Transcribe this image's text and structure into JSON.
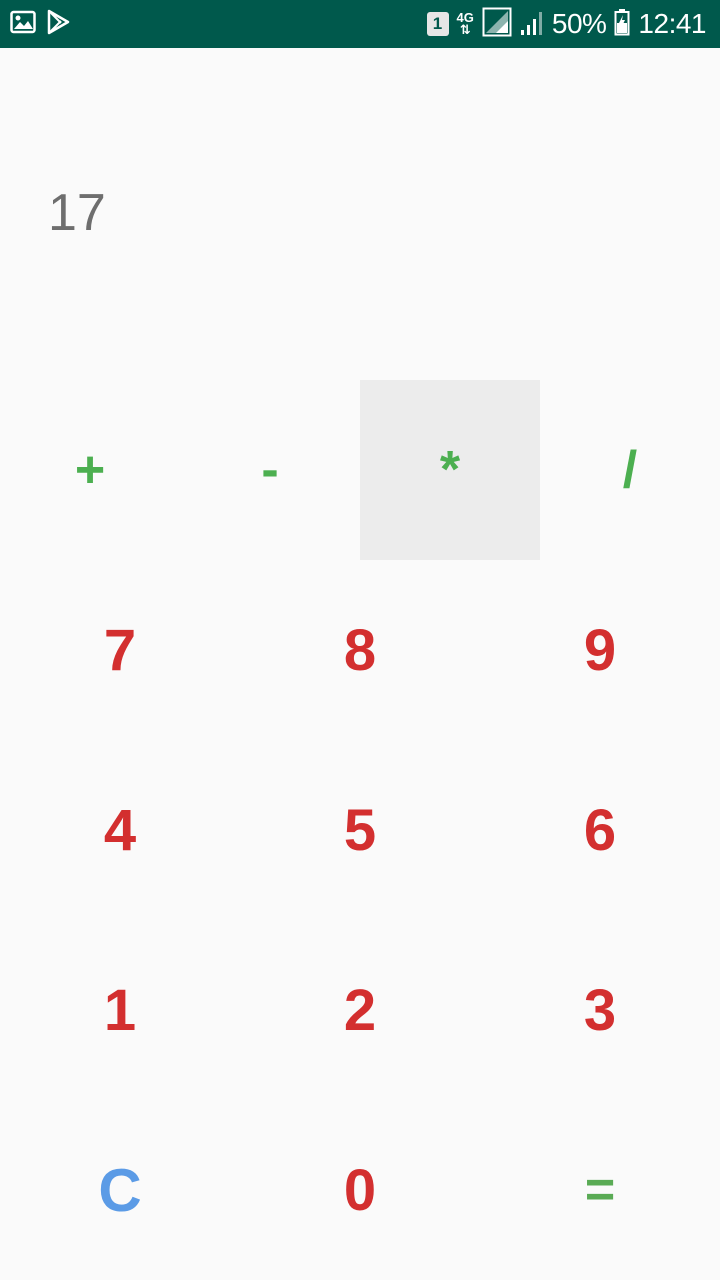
{
  "status_bar": {
    "sim_slot": "1",
    "network": "4G",
    "battery": "50%",
    "time": "12:41",
    "icons": [
      "gallery-icon",
      "play-store-icon",
      "sim-icon",
      "signal-icon",
      "battery-icon"
    ]
  },
  "display": {
    "value": "17"
  },
  "operators": {
    "add": "+",
    "subtract": "-",
    "multiply": "*",
    "divide": "/"
  },
  "keys": {
    "seven": "7",
    "eight": "8",
    "nine": "9",
    "four": "4",
    "five": "5",
    "six": "6",
    "one": "1",
    "two": "2",
    "three": "3",
    "clear": "C",
    "zero": "0",
    "equals": "="
  },
  "colors": {
    "status_bar": "#00594c",
    "operator": "#4caf50",
    "digit": "#d32f2f",
    "clear": "#5b9be6",
    "equals": "#5aab55",
    "pressed_bg": "#ececec"
  }
}
